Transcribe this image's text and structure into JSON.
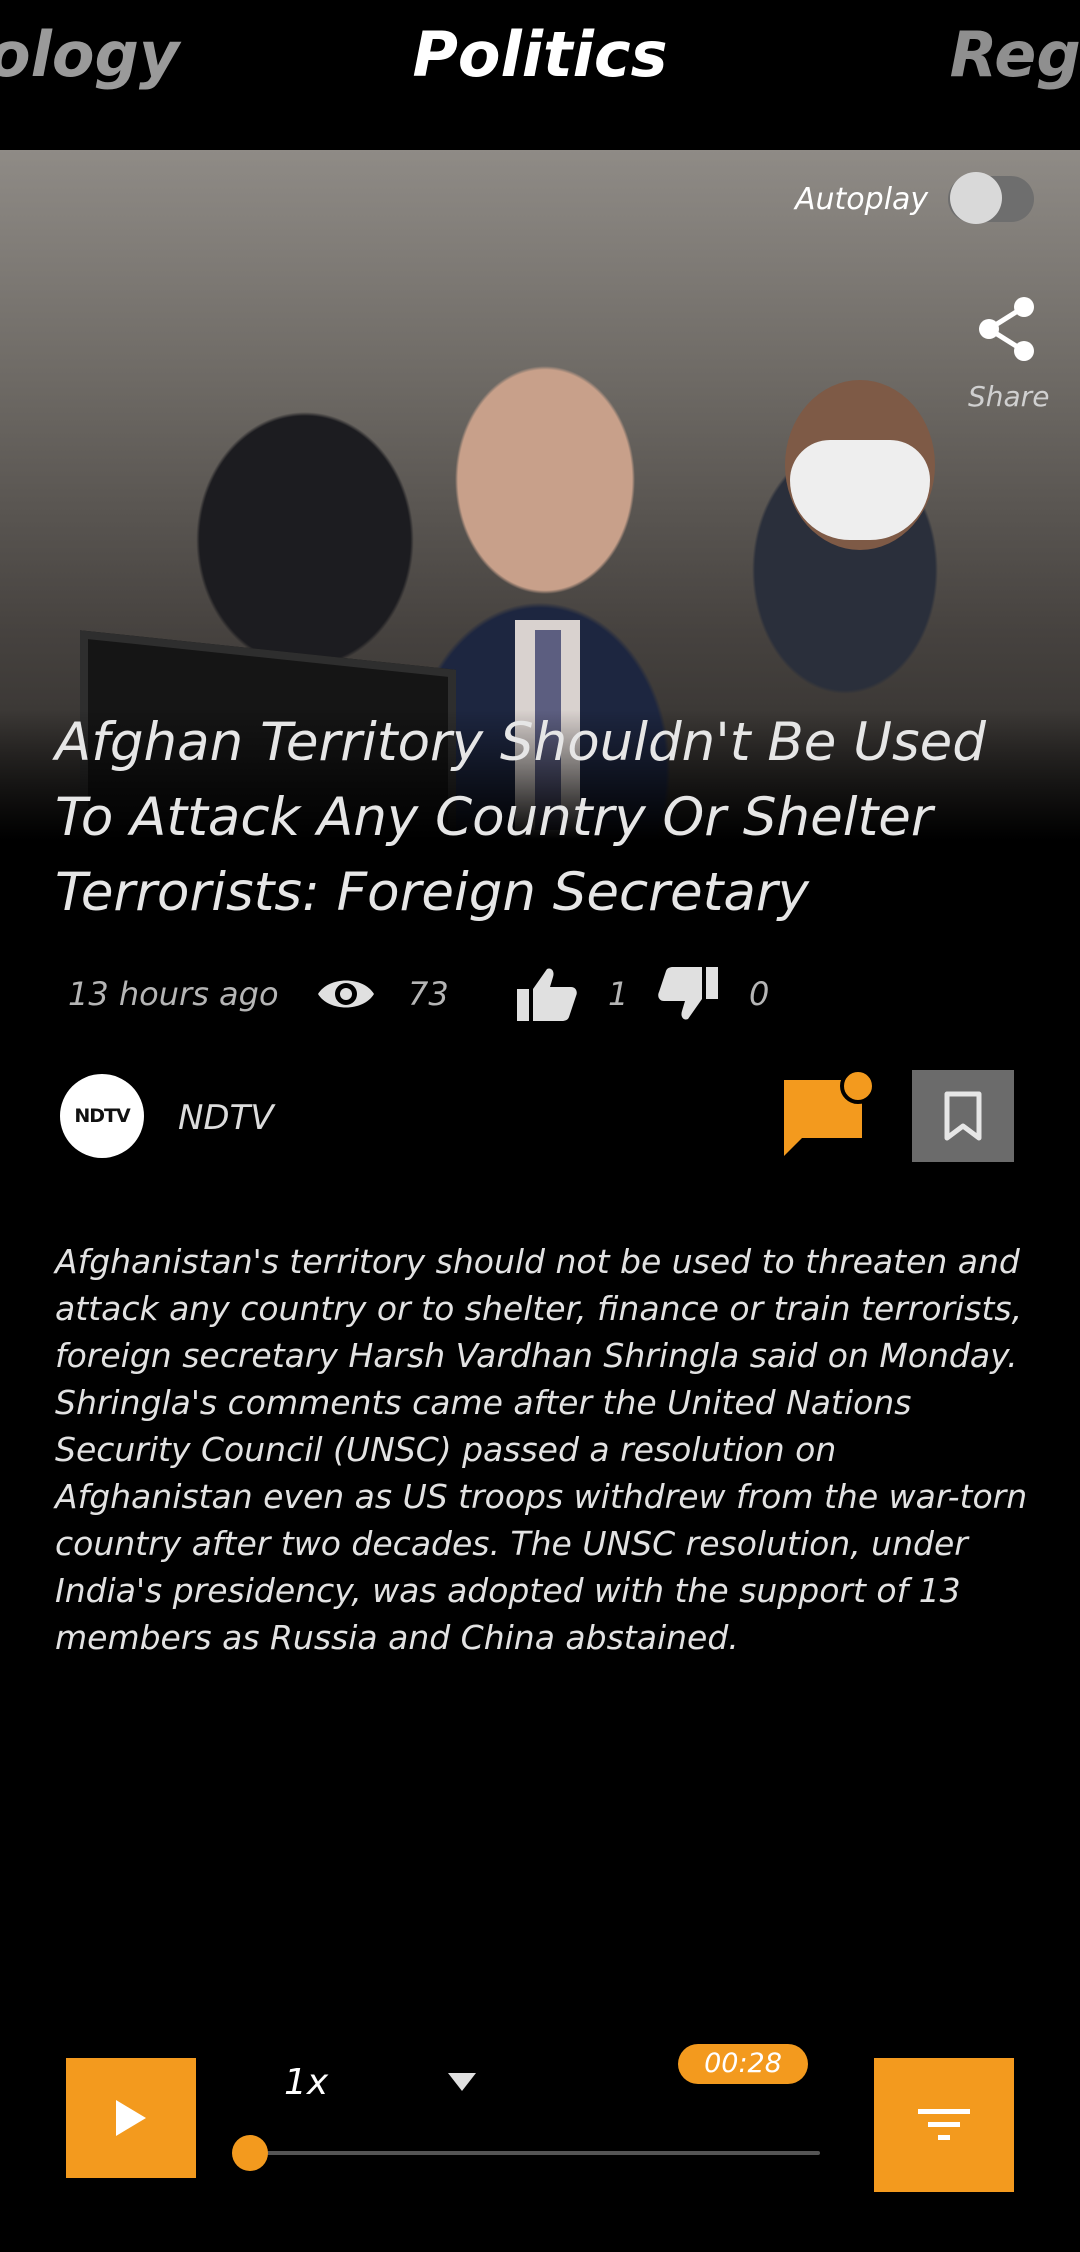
{
  "tabs": {
    "left": "ology",
    "center": "Politics",
    "right": "Regi"
  },
  "controls": {
    "autoplay_label": "Autoplay",
    "autoplay_on": false,
    "share_label": "Share"
  },
  "article": {
    "headline": "Afghan Territory Shouldn't Be Used To Attack Any Country Or Shelter Terrorists: Foreign Secretary",
    "time_ago": "13 hours ago",
    "views": "73",
    "likes": "1",
    "dislikes": "0",
    "source_logo_text": "NDTV",
    "source_name": "NDTV",
    "body": "Afghanistan's territory should not be used to threaten and attack any country or to shelter, finance or train terrorists, foreign secretary Harsh Vardhan Shringla said on Monday. Shringla's comments came after the United Nations Security Council (UNSC) passed a resolution on Afghanistan even as US troops withdrew from the war-torn country after two decades. The UNSC resolution, under India's presidency, was adopted with the support of 13 members as Russia and China abstained."
  },
  "player": {
    "speed": "1x",
    "time": "00:28",
    "progress": 0
  },
  "icons": {
    "share": "share-icon",
    "eye": "eye-icon",
    "like": "thumbs-up-icon",
    "dislike": "thumbs-down-icon",
    "comment": "comment-icon",
    "bookmark": "bookmark-icon",
    "play": "play-icon",
    "caret": "chevron-down-icon",
    "filter": "filter-icon"
  },
  "colors": {
    "accent": "#f39a1e",
    "background": "#000000",
    "muted": "#6b6b6b"
  }
}
